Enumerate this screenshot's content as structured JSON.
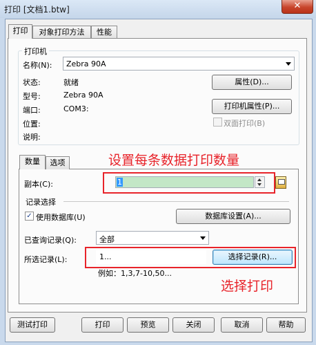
{
  "window": {
    "title": "打印 [文档1.btw]",
    "close_label": "✕"
  },
  "tabs": [
    "打印",
    "对象打印方法",
    "性能"
  ],
  "printer": {
    "group_label": "打印机",
    "name_label": "名称(N):",
    "name_value": "Zebra 90A",
    "status_label": "状态:",
    "status_value": "就绪",
    "model_label": "型号:",
    "model_value": "Zebra 90A",
    "port_label": "端口:",
    "port_value": "COM3:",
    "location_label": "位置:",
    "comment_label": "说明:",
    "properties_button": "属性(D)...",
    "printer_properties_button": "打印机属性(P)...",
    "duplex_label": "双面打印(B)"
  },
  "subtabs": [
    "数量",
    "选项"
  ],
  "annotations": {
    "copies_note": "设置每条数据打印数量",
    "select_note": "选择打印"
  },
  "copies": {
    "label": "副本(C):",
    "value": "1"
  },
  "records": {
    "group_label": "记录选择",
    "use_db_label": "使用数据库(U)",
    "db_settings_button": "数据库设置(A)...",
    "queried_label": "已查询记录(Q):",
    "queried_value": "全部",
    "selected_label": "所选记录(L):",
    "selected_value": "1...",
    "select_button": "选择记录(R)...",
    "example": "例如：1,3,7-10,50..."
  },
  "footer": {
    "test_print": "测试打印",
    "print": "打印",
    "preview": "预览",
    "close": "关闭",
    "cancel": "取消",
    "help": "帮助"
  }
}
